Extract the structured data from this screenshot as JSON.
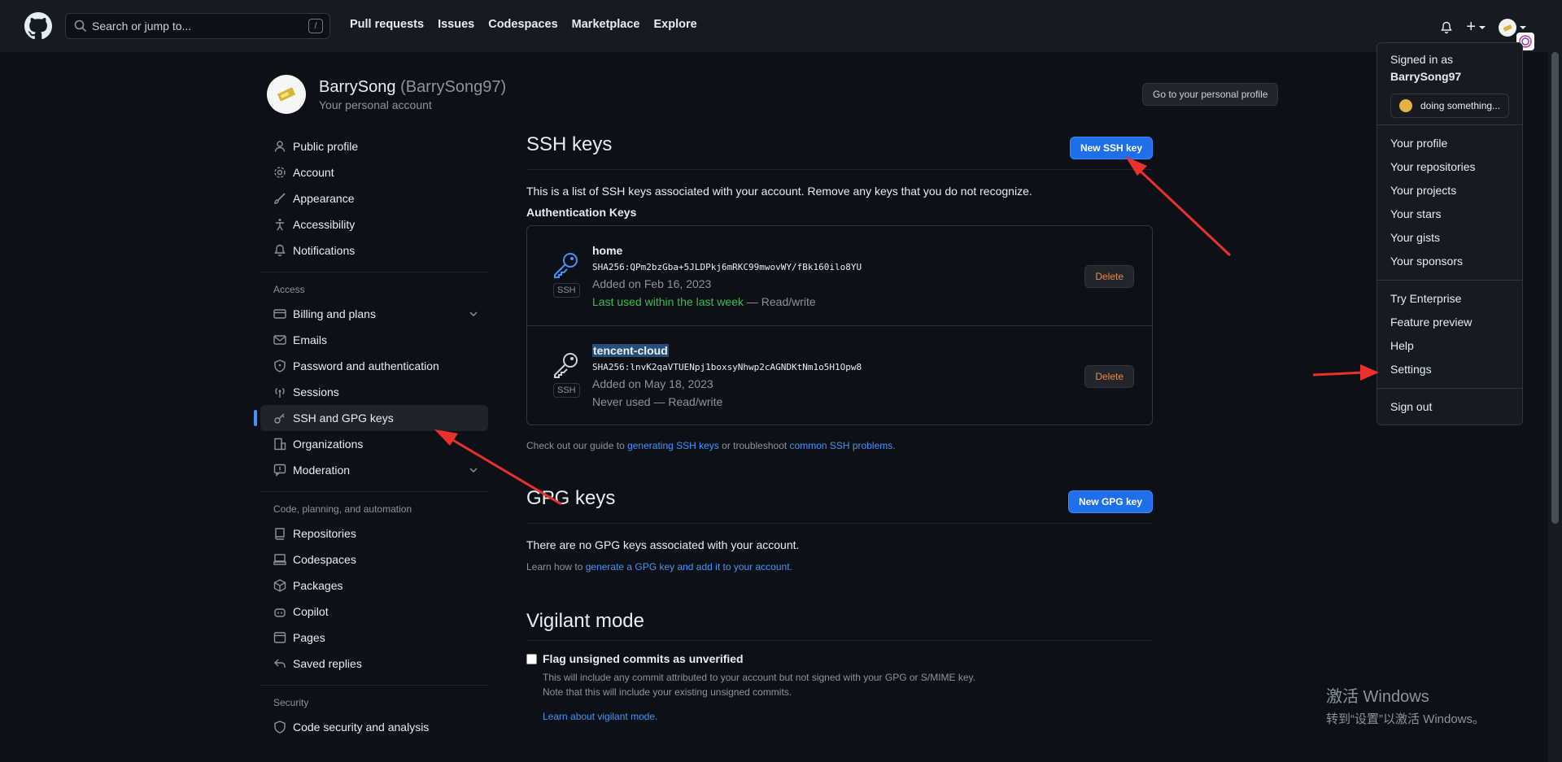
{
  "header": {
    "search_placeholder": "Search or jump to...",
    "search_shortcut": "/",
    "nav": [
      "Pull requests",
      "Issues",
      "Codespaces",
      "Marketplace",
      "Explore"
    ],
    "plus_label": "+"
  },
  "profile": {
    "name": "BarrySong",
    "username": "(BarrySong97)",
    "subtitle": "Your personal account",
    "go_profile_label": "Go to your personal profile"
  },
  "sidebar": {
    "items_top": [
      {
        "label": "Public profile",
        "icon": "person-icon"
      },
      {
        "label": "Account",
        "icon": "gear-icon"
      },
      {
        "label": "Appearance",
        "icon": "paintbrush-icon"
      },
      {
        "label": "Accessibility",
        "icon": "accessibility-icon"
      },
      {
        "label": "Notifications",
        "icon": "bell-icon"
      }
    ],
    "group_access": "Access",
    "items_access": [
      {
        "label": "Billing and plans",
        "icon": "credit-card-icon"
      },
      {
        "label": "Emails",
        "icon": "mail-icon"
      },
      {
        "label": "Password and authentication",
        "icon": "shield-lock-icon"
      },
      {
        "label": "Sessions",
        "icon": "broadcast-icon"
      },
      {
        "label": "SSH and GPG keys",
        "icon": "key-icon"
      },
      {
        "label": "Organizations",
        "icon": "organization-icon"
      },
      {
        "label": "Moderation",
        "icon": "report-icon"
      }
    ],
    "group_code": "Code, planning, and automation",
    "items_code": [
      {
        "label": "Repositories",
        "icon": "repo-icon"
      },
      {
        "label": "Codespaces",
        "icon": "codespaces-icon"
      },
      {
        "label": "Packages",
        "icon": "package-icon"
      },
      {
        "label": "Copilot",
        "icon": "copilot-icon"
      },
      {
        "label": "Pages",
        "icon": "browser-icon"
      },
      {
        "label": "Saved replies",
        "icon": "reply-icon"
      }
    ],
    "group_security": "Security",
    "items_security": [
      {
        "label": "Code security and analysis",
        "icon": "shield-icon"
      }
    ]
  },
  "ssh": {
    "title": "SSH keys",
    "new_button": "New SSH key",
    "description": "This is a list of SSH keys associated with your account. Remove any keys that you do not recognize.",
    "auth_title": "Authentication Keys",
    "badge": "SSH",
    "delete_label": "Delete",
    "keys": [
      {
        "name": "home",
        "fingerprint": "SHA256:QPm2bzGba+5JLDPkj6mRKC99mwovWY/fBk160ilo8YU",
        "added": "Added on Feb 16, 2023",
        "used": "Last used within the last week",
        "access": " — Read/write"
      },
      {
        "name": "tencent-cloud",
        "fingerprint": "SHA256:lnvK2qaVTUENpj1boxsyNhwp2cAGNDKtNm1o5H1Opw8",
        "added": "Added on May 18, 2023",
        "used": "Never used",
        "access": " — Read/write"
      }
    ],
    "guide_prefix": "Check out our guide to ",
    "guide_link1": "generating SSH keys",
    "guide_mid": " or troubleshoot ",
    "guide_link2": "common SSH problems",
    "guide_suffix": "."
  },
  "gpg": {
    "title": "GPG keys",
    "new_button": "New GPG key",
    "empty": "There are no GPG keys associated with your account.",
    "learn_prefix": "Learn how to ",
    "learn_link": "generate a GPG key and add it to your account",
    "learn_suffix": "."
  },
  "vigilant": {
    "title": "Vigilant mode",
    "flag_label": "Flag unsigned commits as unverified",
    "desc1": "This will include any commit attributed to your account but not signed with your GPG or S/MIME key.",
    "desc2": "Note that this will include your existing unsigned commits.",
    "learn_link": "Learn about vigilant mode."
  },
  "dropdown": {
    "signed_in_as": "Signed in as",
    "username": "BarrySong97",
    "status": "doing something...",
    "group1": [
      "Your profile",
      "Your repositories",
      "Your projects",
      "Your stars",
      "Your gists",
      "Your sponsors"
    ],
    "group2": [
      "Try Enterprise",
      "Feature preview",
      "Help",
      "Settings"
    ],
    "sign_out": "Sign out"
  },
  "watermark": {
    "line1": "激活 Windows",
    "line2": "转到“设置”以激活 Windows。"
  },
  "colors": {
    "bg": "#0d1117",
    "header": "#161b22",
    "accent": "#1f6feb",
    "link": "#4493f8",
    "danger": "#f0883e",
    "success": "#3fb950",
    "annotation_arrow": "#e8322b"
  }
}
